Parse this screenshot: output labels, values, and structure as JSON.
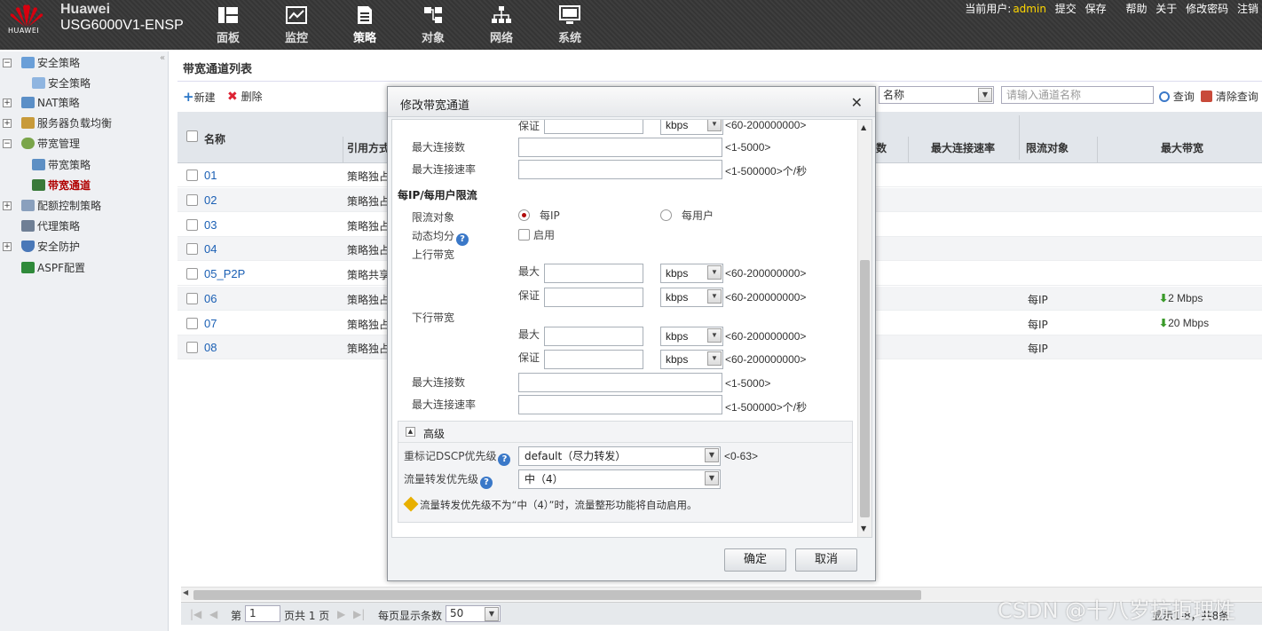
{
  "header": {
    "brand": "Huawei",
    "product": "USG6000V1-ENSP",
    "logo_text": "HUAWEI",
    "nav": [
      {
        "label": "面板",
        "icon": "dashboard-icon"
      },
      {
        "label": "监控",
        "icon": "monitor-chart-icon"
      },
      {
        "label": "策略",
        "icon": "policy-document-icon"
      },
      {
        "label": "对象",
        "icon": "objects-icon"
      },
      {
        "label": "网络",
        "icon": "network-icon"
      },
      {
        "label": "系统",
        "icon": "system-monitor-icon"
      }
    ],
    "active_nav": "策略",
    "user_label": "当前用户:",
    "user": "admin",
    "links": [
      "提交",
      "保存",
      "帮助",
      "关于",
      "修改密码",
      "注销"
    ]
  },
  "sidebar": {
    "items": [
      {
        "label": "安全策略",
        "level": 0,
        "toggle": "-"
      },
      {
        "label": "安全策略",
        "level": 1
      },
      {
        "label": "NAT策略",
        "level": 0,
        "toggle": "+"
      },
      {
        "label": "服务器负载均衡",
        "level": 0,
        "toggle": "+"
      },
      {
        "label": "带宽管理",
        "level": 0,
        "toggle": "-"
      },
      {
        "label": "带宽策略",
        "level": 1
      },
      {
        "label": "带宽通道",
        "level": 1,
        "selected": true
      },
      {
        "label": "配额控制策略",
        "level": 0,
        "toggle": "+"
      },
      {
        "label": "代理策略",
        "level": 0
      },
      {
        "label": "安全防护",
        "level": 0,
        "toggle": "+"
      },
      {
        "label": "ASPF配置",
        "level": 0
      }
    ]
  },
  "main": {
    "title": "带宽通道列表",
    "toolbar": {
      "new_label": "新建",
      "delete_label": "删除"
    },
    "search": {
      "field_value": "名称",
      "placeholder": "请输入通道名称",
      "query_label": "查询",
      "clear_label": "清除查询"
    },
    "columns": {
      "name": "名称",
      "ref": "引用方式",
      "conn_partial": "数",
      "max_conn_rate": "最大连接速率",
      "limit_target": "限流对象",
      "max_bw": "最大带宽"
    },
    "rows": [
      {
        "name": "01",
        "ref": "策略独占",
        "limit": "",
        "bw": ""
      },
      {
        "name": "02",
        "ref": "策略独占",
        "limit": "",
        "bw": ""
      },
      {
        "name": "03",
        "ref": "策略独占",
        "limit": "",
        "bw": ""
      },
      {
        "name": "04",
        "ref": "策略独占",
        "limit": "",
        "bw": ""
      },
      {
        "name": "05_P2P",
        "ref": "策略共享",
        "limit": "",
        "bw": ""
      },
      {
        "name": "06",
        "ref": "策略独占",
        "limit": "每IP",
        "bw": "2 Mbps"
      },
      {
        "name": "07",
        "ref": "策略独占",
        "limit": "每IP",
        "bw": "20 Mbps"
      },
      {
        "name": "08",
        "ref": "策略独占",
        "limit": "每IP",
        "bw": ""
      }
    ],
    "pager": {
      "page_prefix": "第",
      "page": "1",
      "page_suffix": "页共 1 页",
      "per_page_label": "每页显示条数",
      "per_page": "50",
      "summary": "显示1-8，共8条"
    }
  },
  "modal": {
    "title": "修改带宽通道",
    "top_partial": {
      "guarantee_label": "保证",
      "unit": "kbps",
      "range": "<60-200000000>"
    },
    "max_conn_label": "最大连接数",
    "max_conn_hint": "<1-5000>",
    "max_conn_rate_label": "最大连接速率",
    "max_conn_rate_hint": "<1-500000>个/秒",
    "per_ip_section": "每IP/每用户限流",
    "limit_target_label": "限流对象",
    "opt_per_ip": "每IP",
    "opt_per_user": "每用户",
    "dynamic_label": "动态均分",
    "enable_label": "启用",
    "up_label": "上行带宽",
    "down_label": "下行带宽",
    "max_label": "最大",
    "guarantee_label": "保证",
    "unit": "kbps",
    "bw_range": "<60-200000000>",
    "adv_label": "高级",
    "dscp_label": "重标记DSCP优先级",
    "dscp_value": "default（尽力转发）",
    "dscp_range": "<0-63>",
    "fwd_prio_label": "流量转发优先级",
    "fwd_prio_value": "中（4）",
    "notice": "流量转发优先级不为“中（4）”时，流量整形功能将自动启用。",
    "ok_label": "确定",
    "cancel_label": "取消"
  },
  "watermark": "CSDN @十八岁抗拒理性",
  "colors": {
    "topbar": "#3a3a3a",
    "link_blue": "#1a5fb4",
    "selected_red": "#b00000",
    "user_yellow": "#ffd700"
  }
}
